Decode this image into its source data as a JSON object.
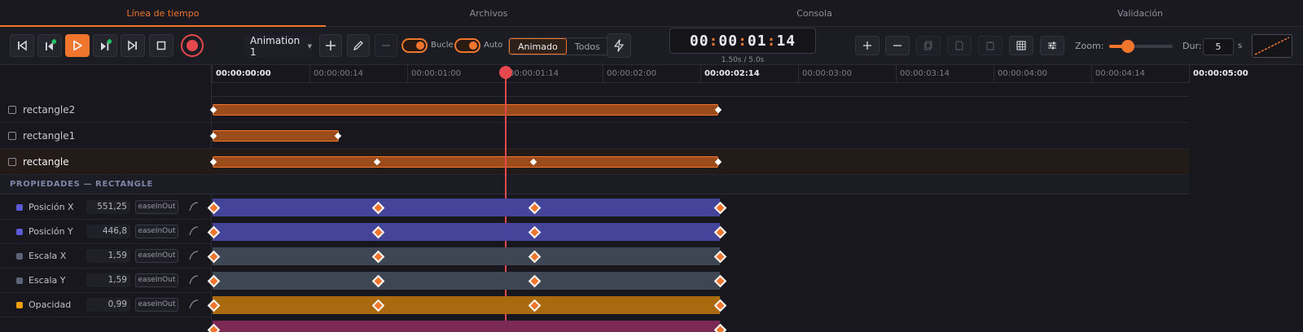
{
  "tabs": [
    "Línea de tiempo",
    "Archivos",
    "Consola",
    "Validación"
  ],
  "toolbar": {
    "animation_name": "Animation 1",
    "loop_label": "Bucle",
    "auto_label": "Auto",
    "segment": [
      "Animado",
      "Todos"
    ],
    "timecode": [
      "00",
      "00",
      "01",
      "14"
    ],
    "time_sub": "1.50s / 5.0s",
    "zoom_label": "Zoom:",
    "zoom_level": 0.3,
    "dur_label": "Dur:",
    "dur_value": "5",
    "dur_unit": "s",
    "accent_color": "#f0762e",
    "record_color": "#e5484d"
  },
  "ruler": {
    "ticks": [
      "00:00:00:00",
      "00:00:00:14",
      "00:00:01:00",
      "00:00:01:14",
      "00:00:02:00",
      "00:00:02:14",
      "00:00:03:00",
      "00:00:03:14",
      "00:00:04:00",
      "00:00:04:14",
      "00:00:05:00"
    ]
  },
  "layers": [
    {
      "name": "rectangle2",
      "selected": false
    },
    {
      "name": "rectangle1",
      "selected": false
    },
    {
      "name": "rectangle",
      "selected": true
    }
  ],
  "section_title": "PROPIEDADES — RECTANGLE",
  "properties": [
    {
      "name": "Posición X",
      "value": "551,25",
      "ease": "easeInOut",
      "color": "#5b5bd6"
    },
    {
      "name": "Posición Y",
      "value": "446,8",
      "ease": "easeInOut",
      "color": "#5b5bd6"
    },
    {
      "name": "Escala X",
      "value": "1,59",
      "ease": "easeInOut",
      "color": "#5a6577"
    },
    {
      "name": "Escala Y",
      "value": "1,59",
      "ease": "easeInOut",
      "color": "#5a6577"
    },
    {
      "name": "Opacidad",
      "value": "0,99",
      "ease": "easeInOut",
      "color": "#f59e0b"
    }
  ]
}
